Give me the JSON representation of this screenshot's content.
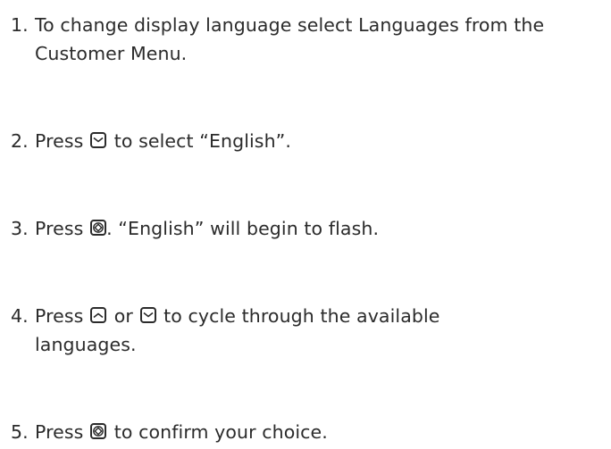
{
  "steps": [
    {
      "number": "1.",
      "line1": "To change display language select Languages from the",
      "line2": "Customer Menu."
    },
    {
      "number": "2.",
      "before": "Press",
      "icon": "down-arrow-button-icon",
      "after": "to select “English”."
    },
    {
      "number": "3.",
      "before": "Press",
      "icon": "enter-button-icon",
      "after": ". “English” will begin to flash."
    },
    {
      "number": "4.",
      "before": "Press",
      "icon1": "up-arrow-button-icon",
      "middle": "or",
      "icon2": "down-arrow-button-icon",
      "after": "to cycle through the available",
      "line2": "languages."
    },
    {
      "number": "5.",
      "before": "Press",
      "icon": "enter-button-icon",
      "after": "to confirm your choice."
    }
  ]
}
